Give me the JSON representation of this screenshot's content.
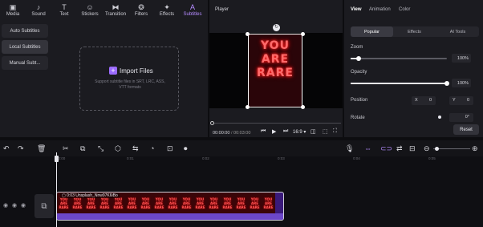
{
  "toolbar": {
    "tools": [
      {
        "label": "Media",
        "icon": "media-icon",
        "glyph": "▣"
      },
      {
        "label": "Sound",
        "icon": "sound-icon",
        "glyph": "♪"
      },
      {
        "label": "Text",
        "icon": "text-icon",
        "glyph": "T"
      },
      {
        "label": "Stickers",
        "icon": "stickers-icon",
        "glyph": "☺"
      },
      {
        "label": "Transition",
        "icon": "transition-icon",
        "glyph": "⧓"
      },
      {
        "label": "Filters",
        "icon": "filters-icon",
        "glyph": "❂"
      },
      {
        "label": "Effects",
        "icon": "effects-icon",
        "glyph": "✦"
      },
      {
        "label": "Subtitles",
        "icon": "subtitles-icon",
        "glyph": "A"
      }
    ],
    "active": "Subtitles",
    "accent": "#b58cff"
  },
  "subtitles_nav": {
    "items": [
      "Auto Subtitles",
      "Local Subtitles",
      "Manual Subt..."
    ],
    "selected": "Local Subtitles"
  },
  "import": {
    "button_label": "Import Files",
    "description": "Support subtitle files in SRT, LRC, ASS, VTT formats"
  },
  "player": {
    "title": "Player",
    "poster_text": "YOU ARE RARE",
    "time_current": "00:00:00",
    "time_total": "00:03:00",
    "aspect_ratio": "16:9",
    "progress": 0.0
  },
  "properties": {
    "tabs": [
      "View",
      "Animation",
      "Color"
    ],
    "active_tab": "View",
    "subtabs": [
      "Popular",
      "Effects",
      "AI Tools"
    ],
    "active_subtab": "Popular",
    "zoom": {
      "label": "Zoom",
      "value": "100%",
      "level": 0.08
    },
    "opacity": {
      "label": "Opacity",
      "value": "100%",
      "level": 1.0
    },
    "position": {
      "label": "Position",
      "x_key": "X",
      "x": "0",
      "y_key": "Y",
      "y": "0"
    },
    "rotate": {
      "label": "Rotate",
      "value": "0°"
    },
    "reset_label": "Reset"
  },
  "timeline": {
    "ticks": [
      "00:00",
      "0:01",
      "0:02",
      "0:03",
      "0:04",
      "0:05"
    ],
    "clip": {
      "label": "0:03 Unsplash_Nnw97K6iBo",
      "frame_text": "YOU ARE RARE",
      "frame_count": 16
    }
  }
}
